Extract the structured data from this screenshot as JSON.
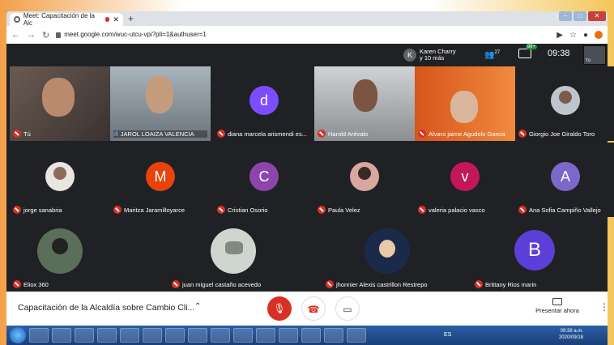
{
  "browser": {
    "tab_title": "Meet: Capacitación de la Alc",
    "url": "meet.google.com/wuc-utcu-vpi?pli=1&authuser=1"
  },
  "meet": {
    "host": {
      "initial": "K",
      "line1": "Karen Charry",
      "line2": "y 10 más"
    },
    "people_count": "27",
    "chat_badge": "99+",
    "time": "09:38",
    "self_thumb_label": "Tú",
    "tiles": [
      {
        "name": "Tú"
      },
      {
        "name": "JAROL LOAIZA VALENCIA"
      },
      {
        "name": "diana marcela arismendi es...",
        "initial": "d",
        "color": "#7c4dff"
      },
      {
        "name": "Harold Arévalo"
      },
      {
        "name": "Alvaro jaime Agudelo Garcia"
      },
      {
        "name": "Giorgio Joe Giraldo Toro"
      },
      {
        "name": "jorge sanabria"
      },
      {
        "name": "Maritza Jaramilloyarce",
        "initial": "M",
        "color": "#e8430c"
      },
      {
        "name": "Cristian Osorio",
        "initial": "C",
        "color": "#8e44ad"
      },
      {
        "name": "Paula Velez"
      },
      {
        "name": "valeria palacio vasco",
        "initial": "v",
        "color": "#c2185b"
      },
      {
        "name": "Ana Sofia Campiño Vallejo",
        "initial": "A",
        "color": "#7b68c9"
      },
      {
        "name": "Eliox 360"
      },
      {
        "name": "juan miguel castaño acevedo"
      },
      {
        "name": "jhonnier Alexis castrillon Restrepo"
      },
      {
        "name": "Brittany Rios marin",
        "initial": "B",
        "color": "#5b3fd6"
      }
    ]
  },
  "bottom": {
    "meeting_title": "Capacitación de la Alcaldía sobre Cambio Cli...",
    "present_label": "Presentar ahora"
  },
  "taskbar": {
    "lang": "ES",
    "time": "09:38 a.m.",
    "date": "2020/09/18"
  }
}
